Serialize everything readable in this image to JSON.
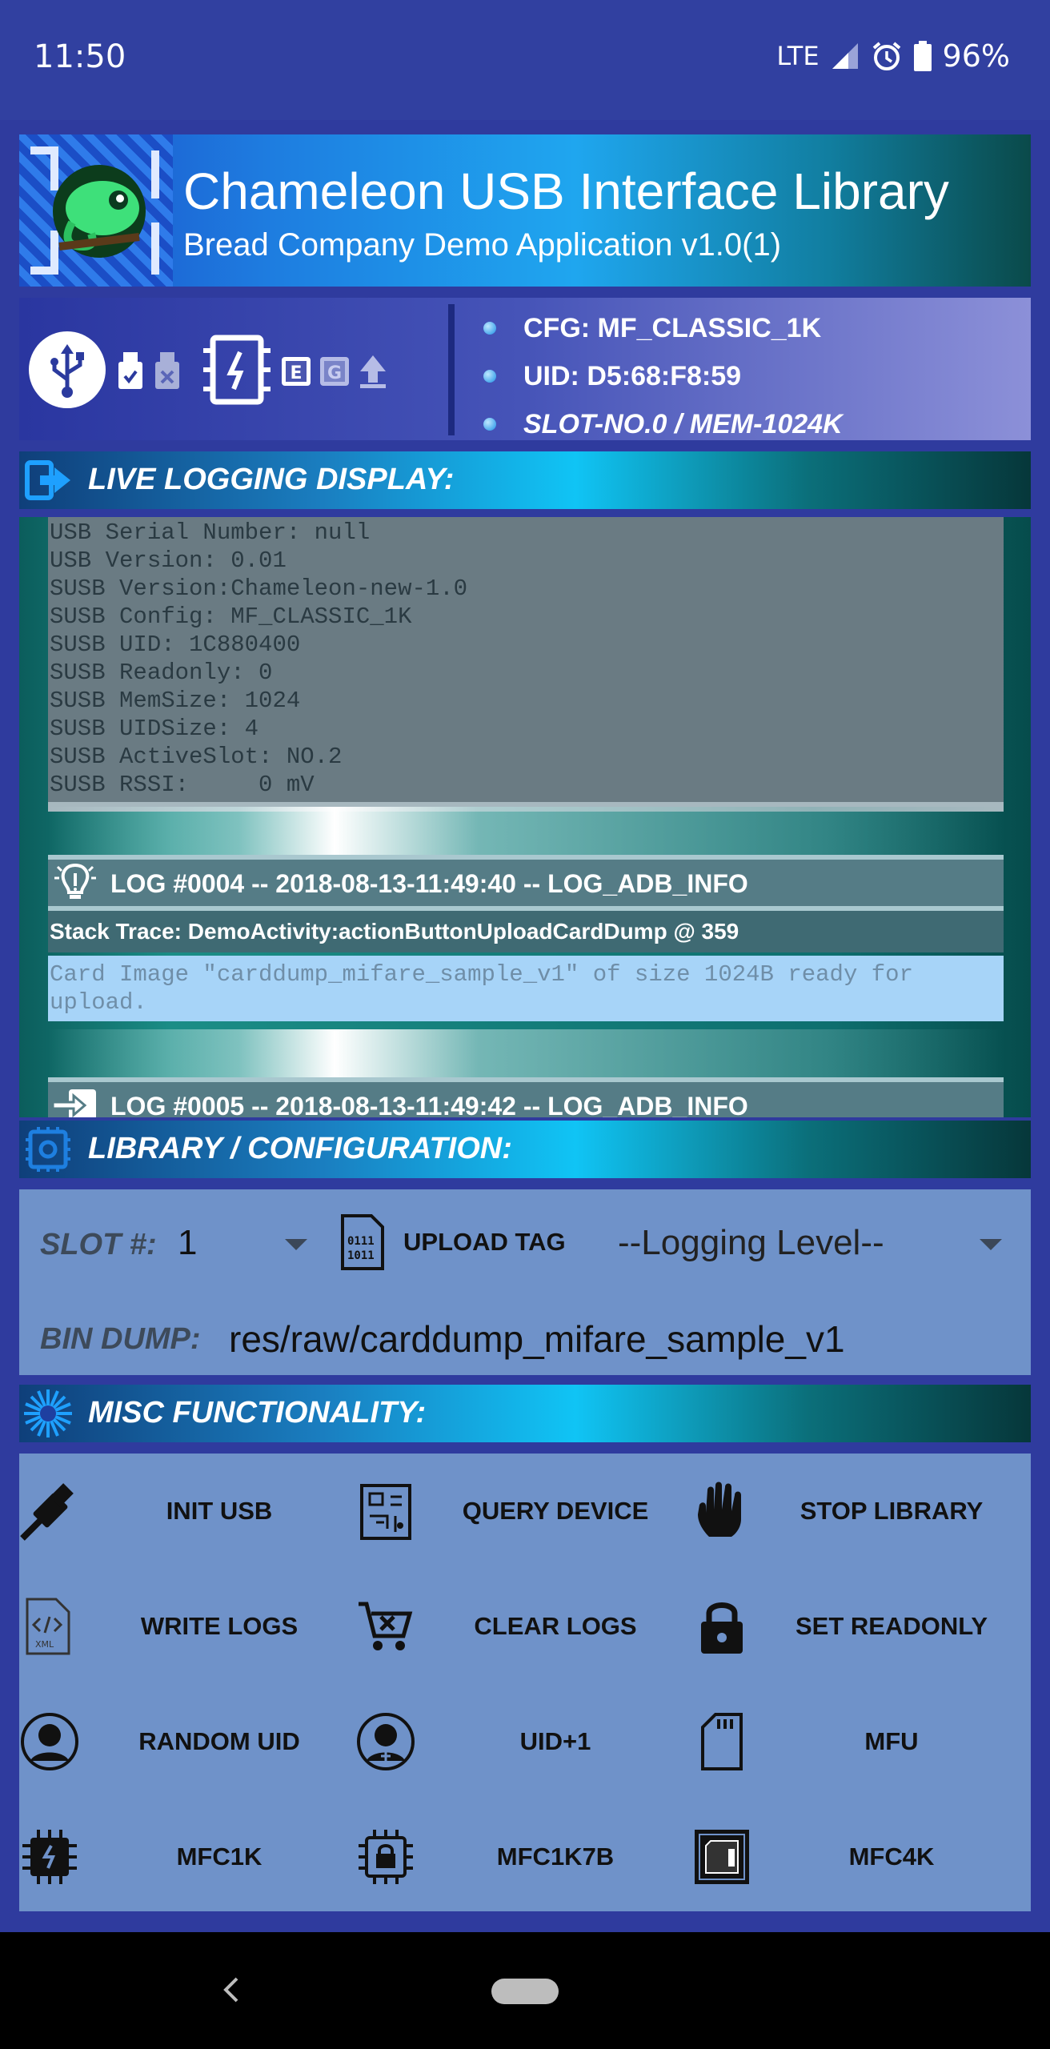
{
  "status_bar": {
    "time": "11:50",
    "network": "LTE",
    "battery": "96%"
  },
  "header": {
    "title": "Chameleon USB Interface Library",
    "subtitle": "Bread Company Demo Application v1.0(1)"
  },
  "device_info": {
    "items": [
      "CFG: MF_CLASSIC_1K",
      "UID: D5:68:F8:59",
      "SLOT-NO.0 / MEM-1024K"
    ]
  },
  "live_logging": {
    "title": "LIVE LOGGING DISPLAY:",
    "lines": [
      "USB Serial Number: null",
      "USB Version: 0.01",
      "SUSB Version:Chameleon-new-1.0",
      "SUSB Config: MF_CLASSIC_1K",
      "SUSB UID: 1C880400",
      "SUSB Readonly: 0",
      "SUSB MemSize: 1024",
      "SUSB UIDSize: 4",
      "SUSB ActiveSlot: NO.2",
      "SUSB RSSI:     0 mV"
    ],
    "entries": [
      {
        "header": "LOG #0004 -- 2018-08-13-11:49:40 -- LOG_ADB_INFO",
        "trace": "Stack Trace: DemoActivity:actionButtonUploadCardDump @ 359",
        "message": "Card Image \"carddump_mifare_sample_v1\" of size 1024B ready for upload."
      },
      {
        "header": "LOG #0005 -- 2018-08-13-11:49:42 -- LOG_ADB_INFO"
      }
    ]
  },
  "library_config": {
    "title": "LIBRARY / CONFIGURATION:",
    "slot_label": "SLOT #:",
    "slot_value": "1",
    "upload_label": "UPLOAD TAG",
    "logging_level": "--Logging Level--",
    "bin_dump_label": "BIN DUMP:",
    "bin_dump_value": "res/raw/carddump_mifare_sample_v1"
  },
  "misc": {
    "title": "MISC FUNCTIONALITY:",
    "buttons": [
      "INIT USB",
      "QUERY DEVICE",
      "STOP LIBRARY",
      "WRITE LOGS",
      "CLEAR LOGS",
      "SET READONLY",
      "RANDOM UID",
      "UID+1",
      "MFU",
      "MFC1K",
      "MFC1K7B",
      "MFC4K"
    ],
    "icons": [
      "usb-plug-icon",
      "circuit-board-icon",
      "hand-stop-icon",
      "xml-file-icon",
      "cart-remove-icon",
      "lock-icon",
      "user-icon",
      "user-plus-icon",
      "sd-card-icon",
      "chip-icon",
      "chip-lock-icon",
      "memory-card-icon"
    ]
  }
}
